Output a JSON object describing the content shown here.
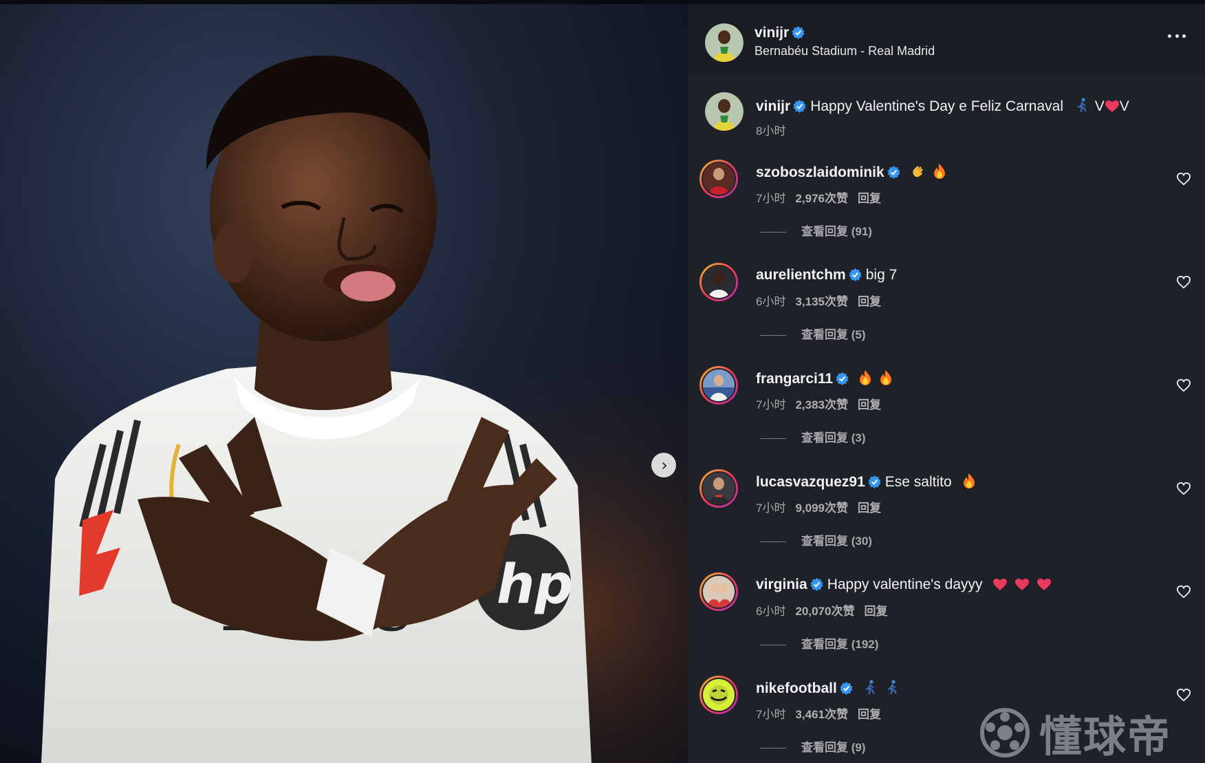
{
  "post": {
    "author": "vinijr",
    "location": "Bernabéu Stadium - Real Madrid",
    "caption_text": "Happy Valentine's Day e Feliz Carnaval",
    "caption_suffix_1": "V",
    "caption_suffix_2": "V",
    "time": "8小时"
  },
  "comments": [
    {
      "user": "szoboszlaidominik",
      "text": "",
      "emojis": [
        "clap",
        "fire"
      ],
      "time": "7小时",
      "likes": "2,976次赞",
      "reply": "回复",
      "replies": "查看回复 (91)"
    },
    {
      "user": "aurelientchm",
      "text": "big 7",
      "emojis": [],
      "time": "6小时",
      "likes": "3,135次赞",
      "reply": "回复",
      "replies": "查看回复 (5)"
    },
    {
      "user": "frangarci11",
      "text": "",
      "emojis": [
        "fire",
        "fire"
      ],
      "time": "7小时",
      "likes": "2,383次赞",
      "reply": "回复",
      "replies": "查看回复 (3)"
    },
    {
      "user": "lucasvazquez91",
      "text": "Ese saltito",
      "emojis": [
        "fire"
      ],
      "time": "7小时",
      "likes": "9,099次赞",
      "reply": "回复",
      "replies": "查看回复 (30)"
    },
    {
      "user": "virginia",
      "text": "Happy valentine's dayyy",
      "emojis": [
        "heart",
        "heart",
        "heart"
      ],
      "time": "6小时",
      "likes": "20,070次赞",
      "reply": "回复",
      "replies": "查看回复 (192)"
    },
    {
      "user": "nikefootball",
      "text": "",
      "emojis": [
        "runner",
        "runner"
      ],
      "time": "7小时",
      "likes": "3,461次赞",
      "reply": "回复",
      "replies": "查看回复 (9)"
    }
  ],
  "watermark": {
    "text": "懂球帝"
  },
  "icons": {
    "verified": "verified-badge-icon",
    "more": "more-options-icon",
    "like": "heart-outline-icon",
    "next": "chevron-right-icon"
  },
  "colors": {
    "panel_bg": "#1e2128",
    "verified": "#3797f0",
    "heart_red": "#e83a5e",
    "fire": "#ff7a1a"
  }
}
